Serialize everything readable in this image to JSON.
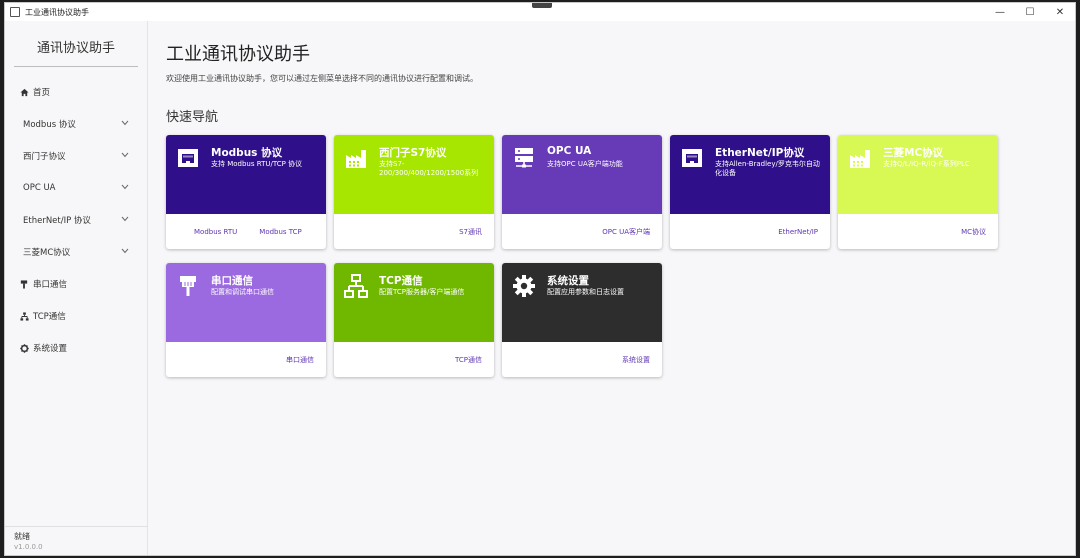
{
  "window": {
    "title": "工业通讯协议助手",
    "controls": {
      "minimize": "—",
      "maximize": "☐",
      "close": "✕"
    }
  },
  "sidebar": {
    "header": "通讯协议助手",
    "items": [
      {
        "label": "首页",
        "icon": "home-icon",
        "expandable": false
      },
      {
        "label": "Modbus 协议",
        "icon": null,
        "expandable": true
      },
      {
        "label": "西门子协议",
        "icon": null,
        "expandable": true
      },
      {
        "label": "OPC UA",
        "icon": null,
        "expandable": true
      },
      {
        "label": "EtherNet/IP 协议",
        "icon": null,
        "expandable": true
      },
      {
        "label": "三菱MC协议",
        "icon": null,
        "expandable": true
      },
      {
        "label": "串口通信",
        "icon": "serial-plug-icon",
        "expandable": false
      },
      {
        "label": "TCP通信",
        "icon": "network-icon",
        "expandable": false
      },
      {
        "label": "系统设置",
        "icon": "gear-icon",
        "expandable": false
      }
    ],
    "status": "就绪",
    "version": "v1.0.0.0"
  },
  "main": {
    "title": "工业通讯协议助手",
    "description": "欢迎使用工业通讯协议助手，您可以通过左侧菜单选择不同的通讯协议进行配置和调试。",
    "section_title": "快速导航",
    "cards": [
      {
        "title": "Modbus 协议",
        "desc": "支持 Modbus RTU/TCP 协议",
        "color": "#30108a",
        "icon": "ethernet-port-icon",
        "links": [
          "Modbus RTU",
          "Modbus TCP"
        ]
      },
      {
        "title": "西门子S7协议",
        "desc": "支持S7-200/300/400/1200/1500系列",
        "color": "#a6e600",
        "icon": "factory-icon",
        "links": [
          "S7通讯"
        ]
      },
      {
        "title": "OPC UA",
        "desc": "支持OPC UA客户端功能",
        "color": "#673ab7",
        "icon": "server-icon",
        "links": [
          "OPC UA客户端"
        ]
      },
      {
        "title": "EtherNet/IP协议",
        "desc": "支持Allen-Bradley/罗克韦尔自动化设备",
        "color": "#30108a",
        "icon": "ethernet-port-icon",
        "links": [
          "EtherNet/IP"
        ]
      },
      {
        "title": "三菱MC协议",
        "desc": "支持Q/L/iQ-R/iQ-F系列PLC",
        "color": "#d8f853",
        "icon": "factory-icon",
        "links": [
          "MC协议"
        ]
      },
      {
        "title": "串口通信",
        "desc": "配置和调试串口通信",
        "color": "#9c6ae0",
        "icon": "serial-plug-icon",
        "links": [
          "串口通信"
        ]
      },
      {
        "title": "TCP通信",
        "desc": "配置TCP服务器/客户端通信",
        "color": "#70b800",
        "icon": "network-icon",
        "links": [
          "TCP通信"
        ]
      },
      {
        "title": "系统设置",
        "desc": "配置应用参数和日志设置",
        "color": "#2d2d2d",
        "icon": "gear-icon",
        "links": [
          "系统设置"
        ]
      }
    ]
  }
}
